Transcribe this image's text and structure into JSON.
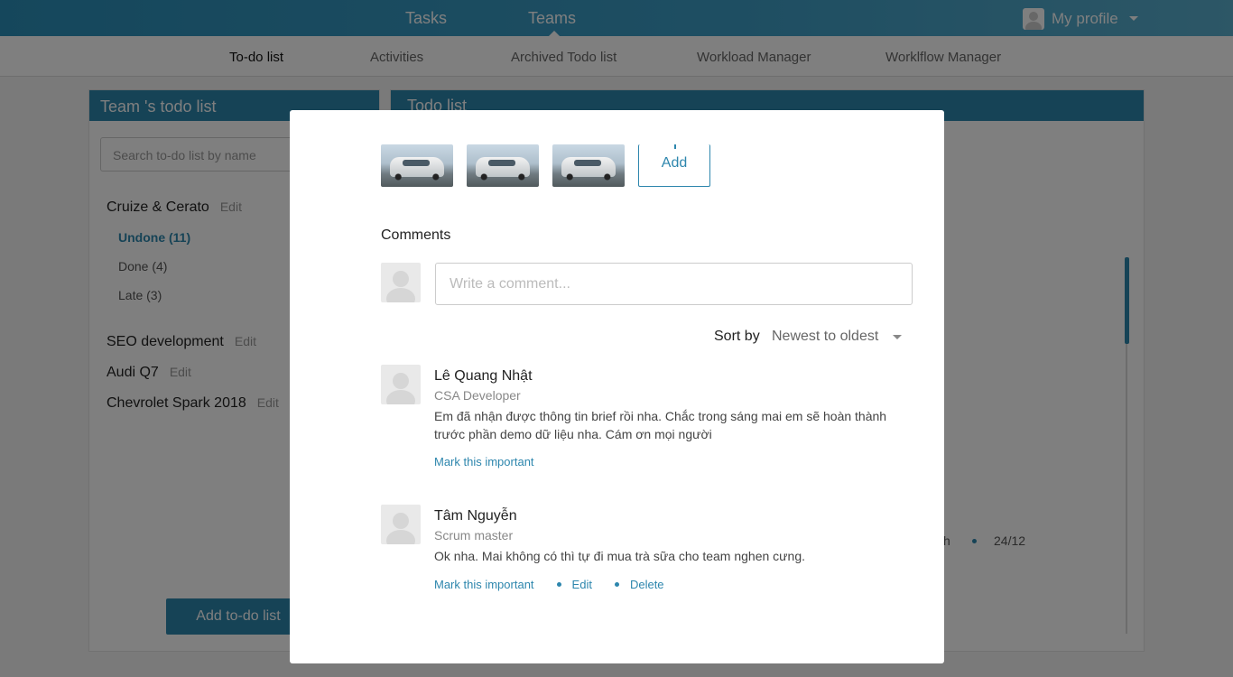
{
  "topbar": {
    "nav": [
      "Tasks",
      "Teams"
    ],
    "profile_label": "My profile"
  },
  "subnav": {
    "items": [
      "To-do list",
      "Activities",
      "Archived Todo list",
      "Workload Manager",
      "Worklflow Manager"
    ],
    "active": "To-do list"
  },
  "left_panel": {
    "title": "Team 's todo list",
    "search_placeholder": "Search to-do list by name",
    "groups": [
      {
        "name": "Cruize & Cerato",
        "edit": "Edit",
        "subitems": [
          "Undone (11)",
          "Done (4)",
          "Late (3)"
        ]
      },
      {
        "name": "SEO development",
        "edit": "Edit"
      },
      {
        "name": "Audi Q7",
        "edit": "Edit"
      },
      {
        "name": "Chevrolet Spark 2018",
        "edit": "Edit"
      }
    ],
    "add_button": "Add to-do list"
  },
  "right_panel": {
    "title": "Todo list",
    "row_fragment": "h",
    "row_date": "24/12"
  },
  "modal": {
    "add_label": "Add",
    "comments_title": "Comments",
    "comment_placeholder": "Write a comment...",
    "sort_label": "Sort by",
    "sort_value": "Newest to oldest",
    "comments": [
      {
        "name": "Lê Quang Nhật",
        "role": "CSA Developer",
        "text": "Em đã nhận được thông tin brief rồi nha. Chắc trong sáng mai em sẽ hoàn thành trước phần demo dữ liệu nha. Cám ơn mọi người",
        "actions": [
          "Mark this important"
        ]
      },
      {
        "name": "Tâm Nguyễn",
        "role": "Scrum master",
        "text": "Ok nha. Mai không có thì tự đi mua trà sữa cho team nghen cưng.",
        "actions": [
          "Mark this important",
          "Edit",
          "Delete"
        ]
      }
    ]
  },
  "colors": {
    "accent": "#2d86ad",
    "topbar": "#3d9dc5"
  }
}
